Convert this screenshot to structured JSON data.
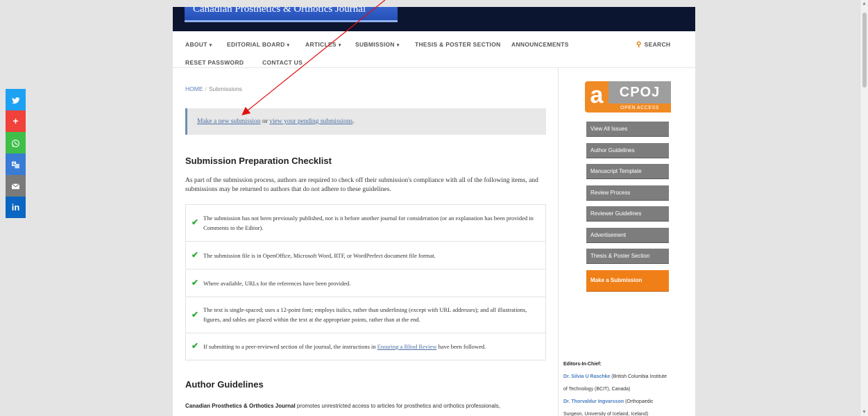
{
  "header": {
    "logo_text": "Canadian Prosthetics & Orthotics Journal"
  },
  "nav": {
    "about": "ABOUT",
    "editorial_board": "EDITORIAL BOARD",
    "articles": "ARTICLES",
    "submission": "SUBMISSION",
    "thesis": "THESIS & POSTER SECTION",
    "announcements": "ANNOUNCEMENTS",
    "search": "SEARCH",
    "reset_password": "RESET PASSWORD",
    "contact_us": "CONTACT US"
  },
  "breadcrumb": {
    "home": "HOME",
    "separator": "/",
    "current": "Submissions"
  },
  "notice": {
    "new_submission": "Make a new submission",
    "or": " or ",
    "pending": "view your pending submissions",
    "end": "."
  },
  "checklist": {
    "title": "Submission Preparation Checklist",
    "intro": "As part of the submission process, authors are required to check off their submission's compliance with all of the following items, and submissions may be returned to authors that do not adhere to these guidelines.",
    "items": [
      "The submission has not been previously published, nor is it before another journal for consideration (or an explanation has been provided in Comments to the Editor).",
      "The submission file is in OpenOffice, Microsoft Word, RTF, or WordPerfect document file format.",
      "Where available, URLs for the references have been provided.",
      "The text is single-spaced; uses a 12-point font; employs italics, rather than underlining (except with URL addresses); and all illustrations, figures, and tables are placed within the text at the appropriate points, rather than at the end."
    ],
    "last_item_pre": "If submitting to a peer-reviewed section of the journal, the instructions in ",
    "last_item_link": "Ensuring a Blind Review",
    "last_item_post": " have been followed."
  },
  "author_guidelines": {
    "title": "Author Guidelines",
    "journal": "Canadian Prosthetics & Orthotics Journal",
    "text": " promotes unrestricted access to articles for prosthetics and orthotics professionals,"
  },
  "sidebar": {
    "oa_letter": "a",
    "oa_cpoj": "CPOJ",
    "oa_open": "OPEN ACCESS",
    "buttons": [
      "View All Issues",
      "Author Guidelines",
      "Manuscript Template",
      "Review Process",
      "Reviewer Guidelines",
      "Advertisement",
      "Thesis & Poster Section"
    ],
    "submit_button": "Make a Submission",
    "editors_title": "Editors-In-Chief:",
    "editor1_name": "Dr. Silvia U Raschke",
    "editor1_aff_a": " (British Columbia Institute",
    "editor1_aff_b": "of Technology (BCIT), Canada)",
    "editor2_name": "Dr. Thorvaldur Ingvarsson",
    "editor2_aff_a": " (Orthopaedic",
    "editor2_aff_b": "Surgeon, University of Iceland, Iceland)"
  },
  "colors": {
    "header_bg": "#0c1530",
    "accent_orange": "#f07f18",
    "sidebar_button": "#7d7d7d",
    "link": "#4a6fa5",
    "check": "#2faa3a",
    "annotation": "#e01010"
  }
}
